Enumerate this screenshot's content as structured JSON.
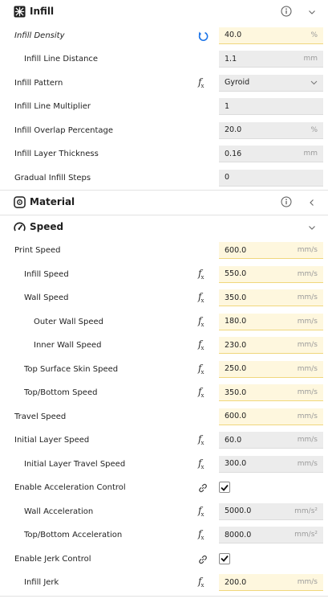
{
  "categories": {
    "infill": {
      "label": "Infill",
      "icon": "infill-category-icon",
      "expanded": true
    },
    "material": {
      "label": "Material",
      "icon": "material-category-icon",
      "expanded": false
    },
    "speed": {
      "label": "Speed",
      "icon": "speed-category-icon",
      "expanded": true
    }
  },
  "settings": {
    "infill_density": {
      "label": "Infill Density",
      "value": "40.0",
      "unit": "%"
    },
    "infill_line_distance": {
      "label": "Infill Line Distance",
      "value": "1.1",
      "unit": "mm"
    },
    "infill_pattern": {
      "label": "Infill Pattern",
      "value": "Gyroid"
    },
    "infill_line_multiplier": {
      "label": "Infill Line Multiplier",
      "value": "1"
    },
    "infill_overlap": {
      "label": "Infill Overlap Percentage",
      "value": "20.0",
      "unit": "%"
    },
    "infill_layer_thickness": {
      "label": "Infill Layer Thickness",
      "value": "0.16",
      "unit": "mm"
    },
    "gradual_infill_steps": {
      "label": "Gradual Infill Steps",
      "value": "0"
    },
    "print_speed": {
      "label": "Print Speed",
      "value": "600.0",
      "unit": "mm/s"
    },
    "infill_speed": {
      "label": "Infill Speed",
      "value": "550.0",
      "unit": "mm/s"
    },
    "wall_speed": {
      "label": "Wall Speed",
      "value": "350.0",
      "unit": "mm/s"
    },
    "outer_wall_speed": {
      "label": "Outer Wall Speed",
      "value": "180.0",
      "unit": "mm/s"
    },
    "inner_wall_speed": {
      "label": "Inner Wall Speed",
      "value": "230.0",
      "unit": "mm/s"
    },
    "top_surface_skin_speed": {
      "label": "Top Surface Skin Speed",
      "value": "250.0",
      "unit": "mm/s"
    },
    "top_bottom_speed": {
      "label": "Top/Bottom Speed",
      "value": "350.0",
      "unit": "mm/s"
    },
    "travel_speed": {
      "label": "Travel Speed",
      "value": "600.0",
      "unit": "mm/s"
    },
    "initial_layer_speed": {
      "label": "Initial Layer Speed",
      "value": "60.0",
      "unit": "mm/s"
    },
    "initial_layer_travel_speed": {
      "label": "Initial Layer Travel Speed",
      "value": "300.0",
      "unit": "mm/s"
    },
    "enable_acceleration_control": {
      "label": "Enable Acceleration Control",
      "checked": true
    },
    "wall_acceleration": {
      "label": "Wall Acceleration",
      "value": "5000.0",
      "unit": "mm/s²"
    },
    "top_bottom_acceleration": {
      "label": "Top/Bottom Acceleration",
      "value": "8000.0",
      "unit": "mm/s²"
    },
    "enable_jerk_control": {
      "label": "Enable Jerk Control",
      "checked": true
    },
    "infill_jerk": {
      "label": "Infill Jerk",
      "value": "200.0",
      "unit": "mm/s"
    }
  },
  "function_icon": {
    "glyph": "f",
    "sub": "x"
  },
  "colors": {
    "modified_field": "#fef7de",
    "default_field": "#ececec",
    "reset_icon": "#1a73e8"
  }
}
